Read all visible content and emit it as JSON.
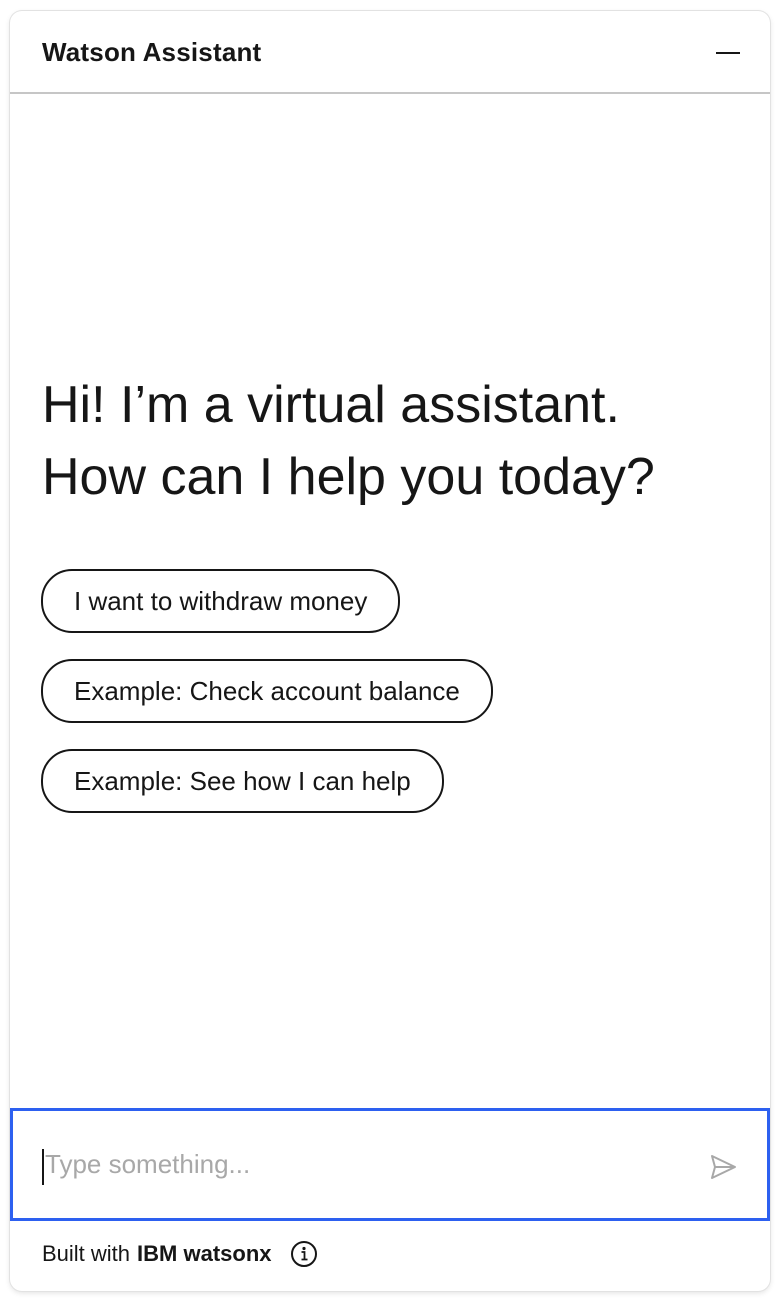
{
  "header": {
    "title": "Watson Assistant",
    "minimize_icon": "minimize-icon"
  },
  "greeting": {
    "line1": "Hi! I’m a virtual assistant.",
    "line2": "How can I help you today?"
  },
  "suggestions": [
    {
      "label": "I want to withdraw money"
    },
    {
      "label": "Example: Check account balance"
    },
    {
      "label": "Example: See how I can help"
    }
  ],
  "input": {
    "placeholder": "Type something...",
    "value": "",
    "send_icon": "send-icon"
  },
  "footer": {
    "built_with": "Built with",
    "brand": "IBM watsonx",
    "info_icon": "info-icon"
  },
  "colors": {
    "focus_border": "#2d60f0",
    "text": "#161616",
    "placeholder": "#a8a8a8",
    "divider": "#c6c6c6"
  }
}
